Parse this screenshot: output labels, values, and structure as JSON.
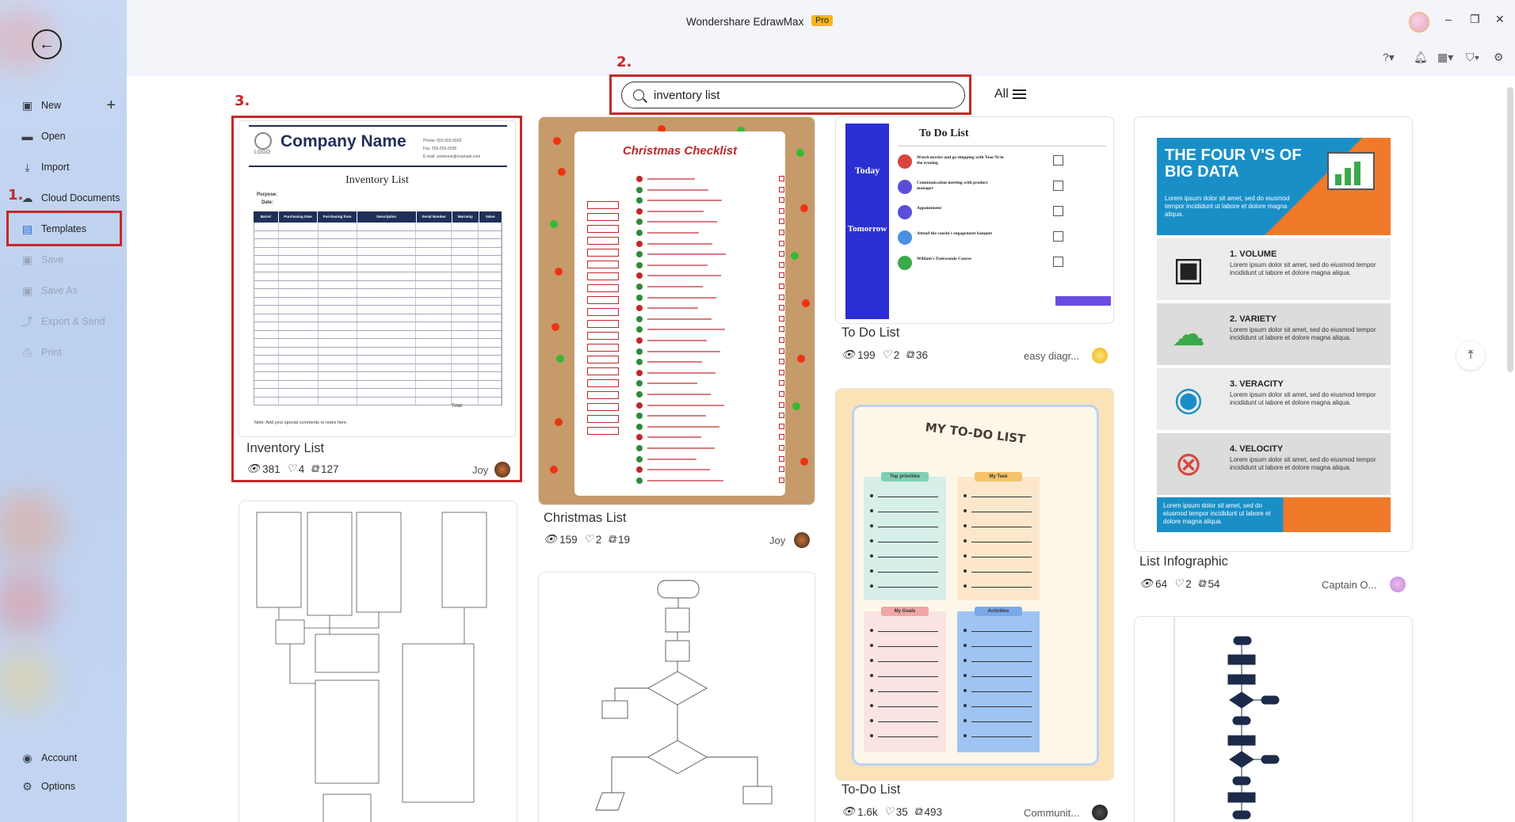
{
  "app": {
    "title": "Wondershare EdrawMax",
    "badge": "Pro"
  },
  "window_controls": {
    "minimize": "–",
    "restore": "❐",
    "close": "✕"
  },
  "sidebar": {
    "items": [
      {
        "label": "New",
        "icon": "new-file-icon",
        "enabled": true
      },
      {
        "label": "Open",
        "icon": "folder-icon",
        "enabled": true
      },
      {
        "label": "Import",
        "icon": "import-icon",
        "enabled": true
      },
      {
        "label": "Cloud Documents",
        "icon": "cloud-icon",
        "enabled": true
      },
      {
        "label": "Templates",
        "icon": "templates-icon",
        "enabled": true,
        "selected": true
      },
      {
        "label": "Save",
        "icon": "save-icon",
        "enabled": false
      },
      {
        "label": "Save As",
        "icon": "save-as-icon",
        "enabled": false
      },
      {
        "label": "Export & Send",
        "icon": "export-icon",
        "enabled": false
      },
      {
        "label": "Print",
        "icon": "print-icon",
        "enabled": false
      }
    ],
    "bottom": [
      {
        "label": "Account",
        "icon": "account-icon"
      },
      {
        "label": "Options",
        "icon": "gear-icon"
      }
    ]
  },
  "annotations": {
    "step1": "1.",
    "step2": "2.",
    "step3": "3."
  },
  "search": {
    "value": "inventory list",
    "placeholder": ""
  },
  "filter": {
    "label": "All"
  },
  "cards": [
    {
      "title": "Inventory List",
      "views": "381",
      "likes": "4",
      "copies": "127",
      "author": "Joy"
    },
    {
      "title": "Christmas List",
      "views": "159",
      "likes": "2",
      "copies": "19",
      "author": "Joy"
    },
    {
      "title": "To Do List",
      "views": "199",
      "likes": "2",
      "copies": "36",
      "author": "easy diagr..."
    },
    {
      "title": "To-Do List",
      "views": "1.6k",
      "likes": "35",
      "copies": "493",
      "author": "Communit..."
    },
    {
      "title": "List Infographic",
      "views": "64",
      "likes": "2",
      "copies": "54",
      "author": "Captain O..."
    }
  ],
  "thumb_inventory": {
    "company": "Company Name",
    "logo": "LOGO",
    "doc_title": "Inventory List",
    "phone": "Phone: 555-555-5555",
    "fax": "Fax: 555-555-5555",
    "email": "E-mail: someone@example.com",
    "purpose": "Purpose:",
    "date": "Date:",
    "columns": [
      "Barrel",
      "Purchasing Date",
      "Purchasing from",
      "Description",
      "Serial Number",
      "Warranty",
      "Value"
    ],
    "total": "Total:",
    "note": "Note: Add your special comments or notes here."
  },
  "thumb_christmas": {
    "title": "Christmas Checklist"
  },
  "thumb_todo": {
    "title": "To Do List",
    "today": "Today",
    "tomorrow": "Tomorrow",
    "items": [
      "Watch movies and go shopping with Xiao Ni in the evening",
      "Communication meeting with product manager",
      "Appointment",
      "Attend the cousin's engagement banquet",
      "William's Taekwondo Course"
    ]
  },
  "thumb_mytodo": {
    "title": "MY TO-DO LIST",
    "sections": [
      "Top priorities",
      "My Task",
      "My Goals",
      "Activities"
    ]
  },
  "thumb_bigdata": {
    "title": "THE FOUR V'S OF BIG DATA",
    "intro": "Lorem ipsum dolor sit amet, sed do eiusmod tempor incididunt ut labore et dolore magna aliqua.",
    "items": [
      {
        "head": "1. VOLUME",
        "body": "Lorem ipsum dolor sit amet, sed do eiusmod tempor incididunt ut labore et dolore magna aliqua."
      },
      {
        "head": "2. VARIETY",
        "body": "Lorem ipsum dolor sit amet, sed do eiusmod tempor incididunt ut labore et dolore magna aliqua."
      },
      {
        "head": "3. VERACITY",
        "body": "Lorem ipsum dolor sit amet, sed do eiusmod tempor incididunt ut labore et dolore magna aliqua."
      },
      {
        "head": "4. VELOCITY",
        "body": "Lorem ipsum dolor sit amet, sed do eiusmod tempor incididunt ut labore et dolore magna aliqua."
      }
    ],
    "footer": "Lorem ipsum dolor sit amet, sed do eiusmod tempor incididunt ut labore et dolore magna aliqua."
  },
  "colors": {
    "accent_red": "#c62828",
    "pro_badge": "#f5b818",
    "sidebar_bg": "#c9d9f3",
    "navy": "#1f2f5a"
  }
}
